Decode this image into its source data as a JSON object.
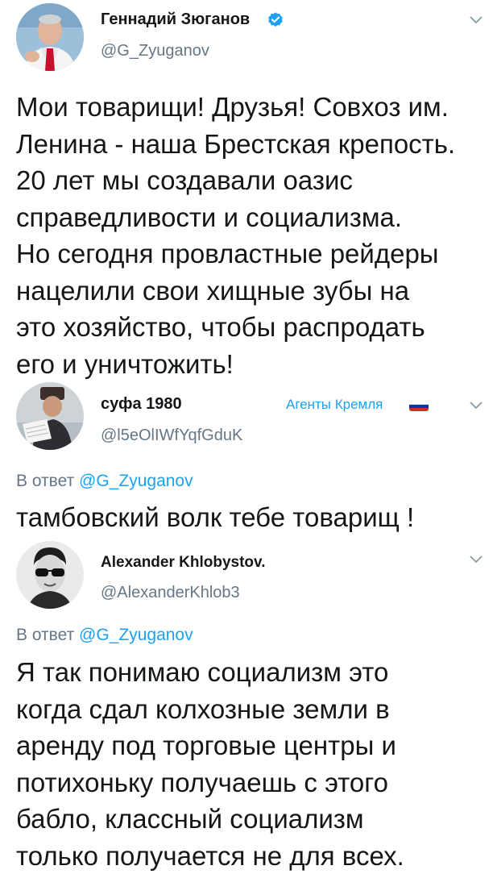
{
  "tweets": [
    {
      "name": "Геннадий Зюганов",
      "handle": "@G_Zyuganov",
      "verified": true,
      "text_lines": [
        "Мои товарищи! Друзья! Совхоз им.",
        "Ленина - наша Брестская крепость.",
        "20 лет мы создавали оазис",
        "справедливости и социализма.",
        "Но сегодня провластные рейдеры",
        "нацелили свои хищные зубы на",
        "это хозяйство, чтобы распродать",
        "его и уничтожить!"
      ],
      "avatar_icon": "user-avatar-red-tie"
    },
    {
      "name": "суфа 1980",
      "handle": "@l5eOlIWfYqfGduK",
      "badge": "Агенты Кремля",
      "badge_icon": "russian-flag-icon",
      "reply_prefix": "В ответ",
      "reply_mention": "@G_Zyuganov",
      "text_lines": [
        "тамбовский волк тебе товарищ !"
      ],
      "avatar_icon": "user-avatar-papakha"
    },
    {
      "name": "Alexander Khlobystov.",
      "handle": "@AlexanderKhlob3",
      "reply_prefix": "В ответ",
      "reply_mention": "@G_Zyuganov",
      "text_lines": [
        "Я так понимаю социализм это",
        "когда сдал колхозные земли в",
        "аренду под торговые центры и",
        "потихоньку получаешь с этого",
        "бабло, классный социализм",
        "только получается не для всех."
      ],
      "avatar_icon": "user-avatar-sunglasses"
    }
  ],
  "colors": {
    "text": "#14171a",
    "secondary": "#657786",
    "accent": "#1da1f2"
  }
}
